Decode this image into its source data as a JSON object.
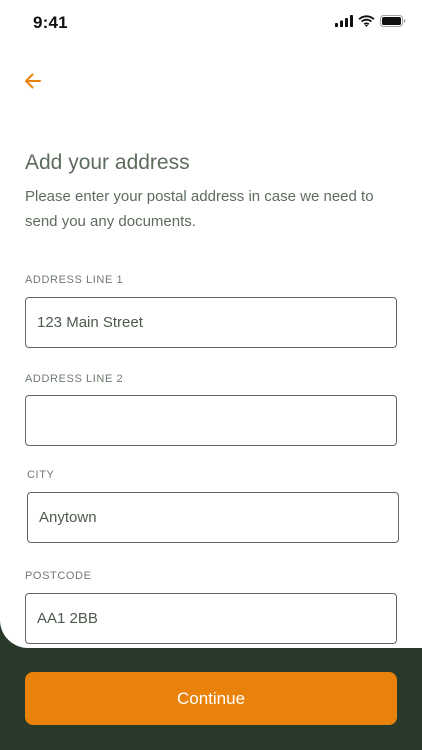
{
  "status_bar": {
    "time": "9:41",
    "icons": [
      "cellular-signal-icon",
      "wifi-icon",
      "battery-icon"
    ]
  },
  "nav": {
    "back_icon": "arrow-left-icon"
  },
  "header": {
    "title": "Add your address",
    "subtitle": "Please enter your postal address in case we need to send you any documents."
  },
  "form": {
    "address_line_1": {
      "label": "ADDRESS LINE 1",
      "value": "123 Main Street"
    },
    "address_line_2": {
      "label": "ADDRESS LINE 2",
      "value": ""
    },
    "city": {
      "label": "CITY",
      "value": "Anytown"
    },
    "postcode": {
      "label": "POSTCODE",
      "value": "AA1 2BB"
    }
  },
  "footer": {
    "continue_label": "Continue"
  },
  "colors": {
    "accent": "#e8820a",
    "footer_background": "#2a3a2a",
    "text": "#5e6c5e"
  }
}
